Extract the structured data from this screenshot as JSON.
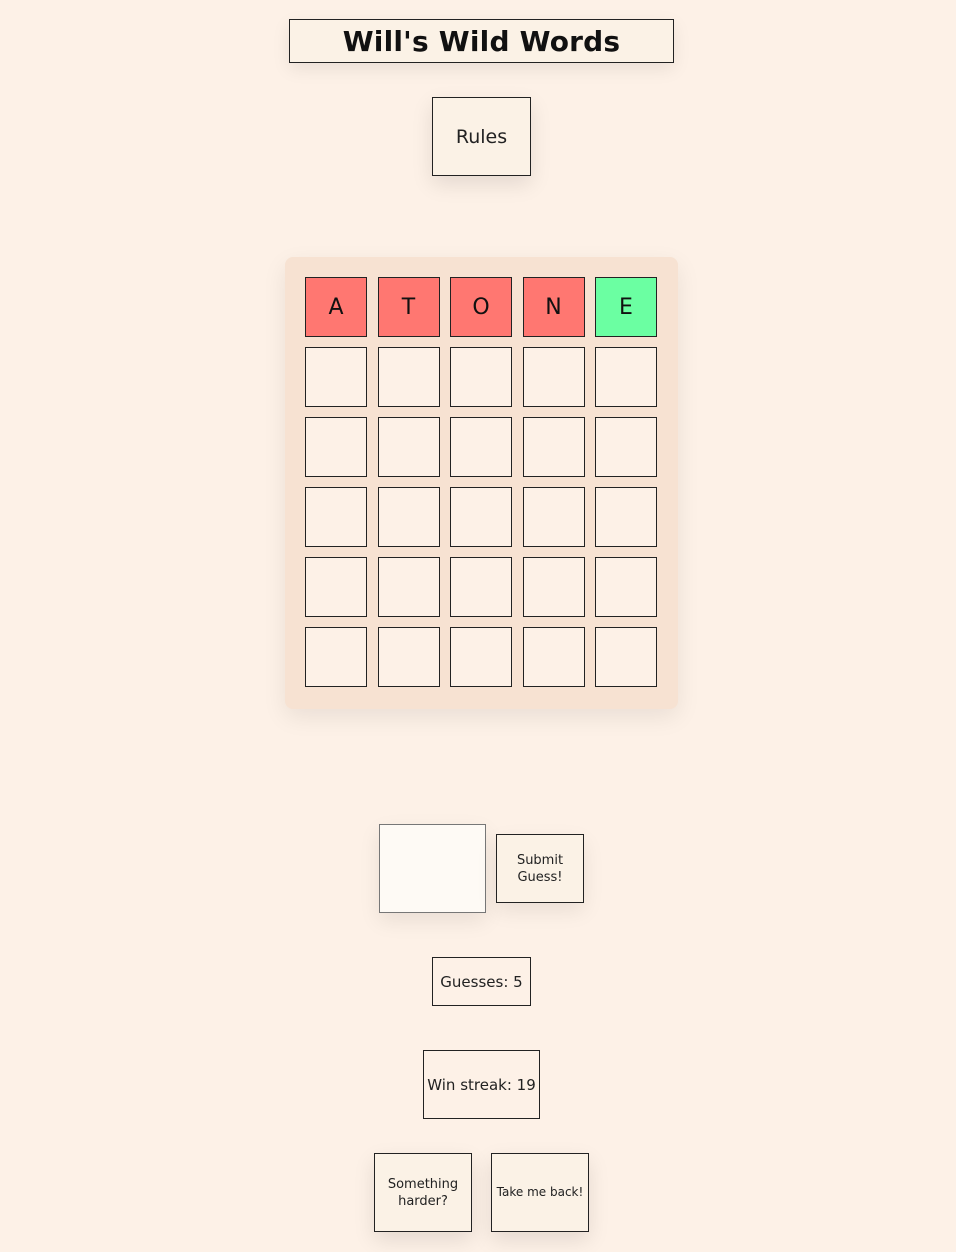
{
  "header": {
    "title": "Will's Wild Words"
  },
  "rules_button": {
    "label": "Rules"
  },
  "board": {
    "colors": {
      "absent": "#ff7771",
      "correct": "#6bffa2",
      "empty": "#fdf1e7"
    },
    "rows": [
      [
        {
          "letter": "A",
          "state": "absent"
        },
        {
          "letter": "T",
          "state": "absent"
        },
        {
          "letter": "O",
          "state": "absent"
        },
        {
          "letter": "N",
          "state": "absent"
        },
        {
          "letter": "E",
          "state": "correct"
        }
      ],
      [
        {
          "letter": "",
          "state": "empty"
        },
        {
          "letter": "",
          "state": "empty"
        },
        {
          "letter": "",
          "state": "empty"
        },
        {
          "letter": "",
          "state": "empty"
        },
        {
          "letter": "",
          "state": "empty"
        }
      ],
      [
        {
          "letter": "",
          "state": "empty"
        },
        {
          "letter": "",
          "state": "empty"
        },
        {
          "letter": "",
          "state": "empty"
        },
        {
          "letter": "",
          "state": "empty"
        },
        {
          "letter": "",
          "state": "empty"
        }
      ],
      [
        {
          "letter": "",
          "state": "empty"
        },
        {
          "letter": "",
          "state": "empty"
        },
        {
          "letter": "",
          "state": "empty"
        },
        {
          "letter": "",
          "state": "empty"
        },
        {
          "letter": "",
          "state": "empty"
        }
      ],
      [
        {
          "letter": "",
          "state": "empty"
        },
        {
          "letter": "",
          "state": "empty"
        },
        {
          "letter": "",
          "state": "empty"
        },
        {
          "letter": "",
          "state": "empty"
        },
        {
          "letter": "",
          "state": "empty"
        }
      ],
      [
        {
          "letter": "",
          "state": "empty"
        },
        {
          "letter": "",
          "state": "empty"
        },
        {
          "letter": "",
          "state": "empty"
        },
        {
          "letter": "",
          "state": "empty"
        },
        {
          "letter": "",
          "state": "empty"
        }
      ]
    ]
  },
  "guess_form": {
    "input_value": "",
    "input_placeholder": "",
    "submit_label": "Submit Guess!"
  },
  "stats": {
    "guesses_text": "Guesses: 5",
    "win_streak_text": "Win streak: 19"
  },
  "bottom_buttons": {
    "harder_label": "Something harder?",
    "back_label": "Take me back!"
  }
}
